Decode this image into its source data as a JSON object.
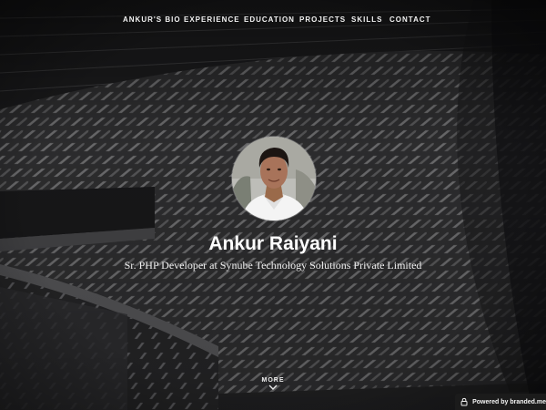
{
  "nav": {
    "items": [
      {
        "label": "ANKUR'S BIO"
      },
      {
        "label": "EXPERIENCE"
      },
      {
        "label": "EDUCATION"
      },
      {
        "label": "PROJECTS"
      },
      {
        "label": "SKILLS"
      },
      {
        "label": "CONTACT"
      }
    ]
  },
  "profile": {
    "name": "Ankur Raiyani",
    "title": "Sr. PHP Developer at Synube Technology Solutions Private Limited"
  },
  "more": {
    "label": "MORE",
    "icon": "chevron-down-icon"
  },
  "badge": {
    "label": "Powered by branded.me",
    "icon": "lock-icon"
  },
  "colors": {
    "background": "#1d1d1f",
    "text": "#ffffff",
    "badge_bg": "#1b1b1b"
  }
}
